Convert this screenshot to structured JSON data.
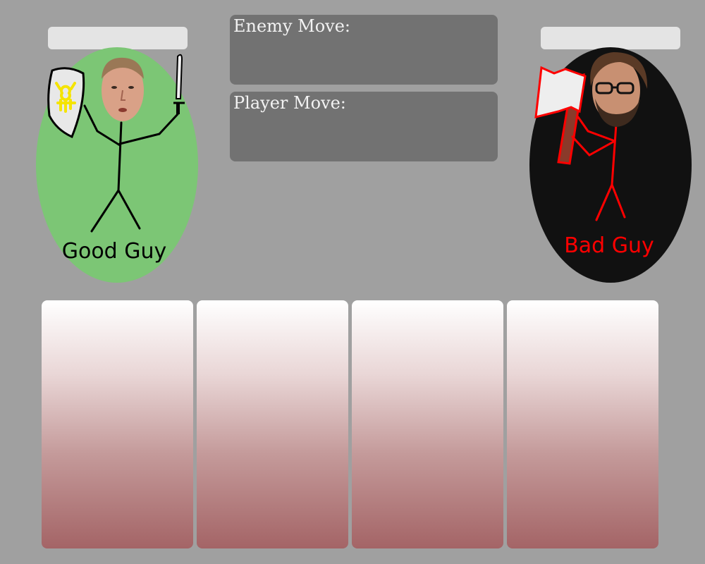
{
  "player": {
    "label": "Good Guy",
    "health": "",
    "portrait_color": "#7cc675",
    "figure_color": "#000000",
    "emblem_color": "#f5e400"
  },
  "enemy": {
    "label": "Bad Guy",
    "health": "",
    "portrait_color": "#111111",
    "figure_color": "#ff0000"
  },
  "moves": {
    "enemy_label": "Enemy Move:",
    "enemy_value": "",
    "player_label": "Player Move:",
    "player_value": ""
  },
  "cards": [
    {
      "label": ""
    },
    {
      "label": ""
    },
    {
      "label": ""
    },
    {
      "label": ""
    }
  ],
  "colors": {
    "background": "#a0a0a0",
    "health_bar": "#e4e4e4",
    "move_panel": "#727272",
    "card_top": "#ffffff",
    "card_bottom": "#a46466"
  }
}
